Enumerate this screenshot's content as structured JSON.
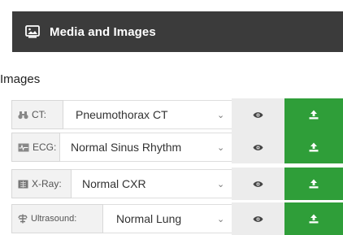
{
  "header": {
    "title": "Media and Images",
    "icon": "image-icon"
  },
  "section": {
    "label": "Images"
  },
  "rows": [
    {
      "type_label": "CT:",
      "type_icon": "binoculars-icon",
      "selected": "Pneumothorax CT"
    },
    {
      "type_label": "ECG:",
      "type_icon": "ecg-icon",
      "selected": "Normal Sinus Rhythm"
    },
    {
      "type_label": "X-Ray:",
      "type_icon": "xray-icon",
      "selected": "Normal CXR"
    },
    {
      "type_label": "Ultrasound:",
      "type_icon": "ultrasound-icon",
      "selected": "Normal Lung"
    }
  ],
  "actions": {
    "view_icon": "eye-icon",
    "upload_icon": "upload-icon"
  },
  "colors": {
    "header_bg": "#3b3b3b",
    "upload_green": "#2f9e39",
    "view_bg": "#ececec"
  }
}
